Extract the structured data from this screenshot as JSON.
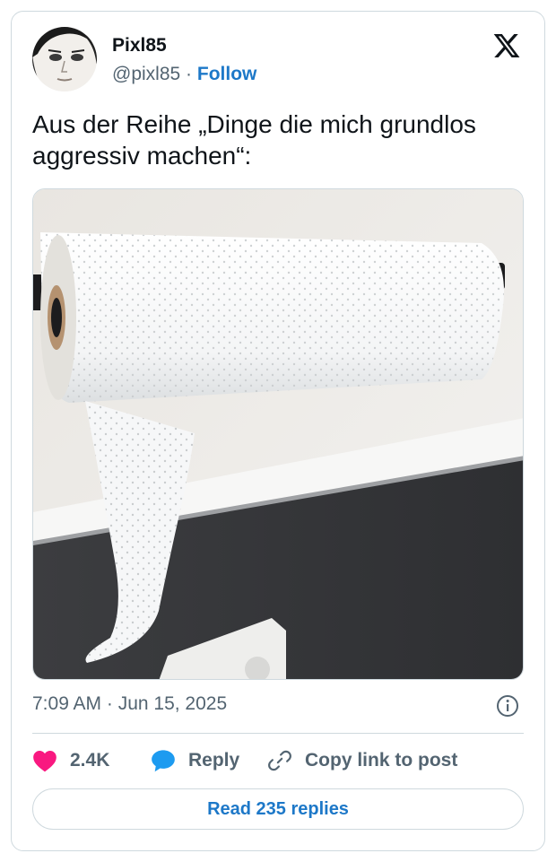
{
  "author": {
    "name": "Pixl85",
    "handle": "@pixl85",
    "separator": "·",
    "follow_label": "Follow",
    "avatar_icon": "face-portrait-avatar"
  },
  "brand": {
    "logo_icon": "x-logo-icon"
  },
  "tweet": {
    "text": "Aus der Reihe „Dinge die mich grundlos aggressiv machen“:",
    "media_description_icon": "paper-towel-roll-photo"
  },
  "meta": {
    "timestamp": "7:09 AM · Jun 15, 2025",
    "info_icon": "info-icon"
  },
  "actions": {
    "likes": {
      "icon": "heart-icon",
      "count": "2.4K",
      "color": "#f91880"
    },
    "reply": {
      "icon": "reply-bubble-icon",
      "label": "Reply",
      "color": "#1d9bf0"
    },
    "copy_link": {
      "icon": "link-icon",
      "label": "Copy link to post"
    }
  },
  "read_replies": {
    "label": "Read 235 replies"
  },
  "colors": {
    "accent": "#1d78c8",
    "muted_text": "#536471",
    "border": "#cfd9de",
    "like": "#f91880",
    "reply": "#1d9bf0"
  }
}
